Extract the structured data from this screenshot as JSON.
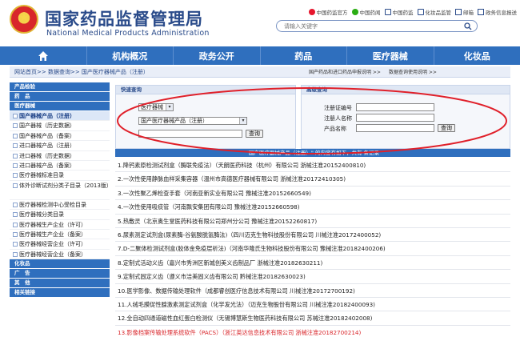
{
  "header": {
    "title": "国家药品监督管理局",
    "subtitle": "National Medical Products Administration",
    "links": [
      {
        "icon": "weibo-icon",
        "label": "中国药监官方"
      },
      {
        "icon": "wechat-icon",
        "label": "中国药闻"
      },
      {
        "icon": "phone-icon",
        "label": "中国药监"
      },
      {
        "icon": "phone-icon",
        "label": "化妆品监管"
      },
      {
        "icon": "mail-icon",
        "label": "邮箱"
      },
      {
        "icon": "mail-icon",
        "label": "政务信息报送"
      }
    ],
    "search_placeholder": "请输入关键字"
  },
  "nav": {
    "home_icon": "home-icon",
    "items": [
      "机构概况",
      "政务公开",
      "药品",
      "医疗器械",
      "化妆品"
    ]
  },
  "breadcrumb": {
    "path": "网站首页>> 数据查询>> 国产医疗器械产品（注册）",
    "links": [
      "国产药品和进口药品申报说明 >>",
      "数据查询使用说明 >>"
    ]
  },
  "sidebar": {
    "cats": [
      "产品检验",
      "药　品",
      "医疗器械",
      "化妆品",
      "广　告",
      "其　他",
      "相关链接"
    ],
    "items": [
      "国产器械产品（注册）",
      "国产器械（历史数据）",
      "国产器械产品（备案）",
      "进口器械产品（注册）",
      "进口器械（历史数据）",
      "进口器械产品（备案）",
      "医疗器械标准目录",
      "体外诊断试剂分类子目录（2013版）",
      "医疗器械检测中心受检目录",
      "医疗器械分类目录",
      "医疗器械生产企业（许可）",
      "医疗器械生产企业（备案）",
      "医疗器械经营企业（许可）",
      "医疗器械经营企业（备案）"
    ]
  },
  "quick": {
    "title": "快速查询",
    "cat_value": "医疗器械",
    "db_value": "国产医疗器械产品（注册）",
    "button": "查询"
  },
  "advanced": {
    "title": "高级查询",
    "fields": [
      "注册证编号",
      "注册人名称",
      "产品名称"
    ],
    "button": "查询"
  },
  "results": {
    "header": "\"国产医疗器械产品（注册）\" 的内容有如下，共有 条记录",
    "rows": [
      "1.降钙素原检测试剂盒（酶联免疫法）（天朗医药科技（杭州）有限公司 浙械注准20152400810)",
      "2.一次性使用静脉血样采集容器（温州市高德医疗器械有限公司 浙械注准20172410305)",
      "3.一次性聚乙烯检查手套（河南亚新实业有限公司 豫械注准20152660549)",
      "4.一次性使用吸痰管（河南飘安集团有限公司 豫械注准20152660598)",
      "5.热敷灵（北京奥生堂医药科技有限公司郑州分公司 豫械注准20152260817)",
      "6.尿素测定试剂盒(尿素酶-谷氨酸脱氢酶法)（四川迈克生物科技股份有限公司 川械注准20172400052)",
      "7.D-二聚体检测试剂盒(胶体金免疫层析法)（河南华隆氏生物科技股份有限公司 豫械注准20182400206)",
      "8.定制式活动义齿（嘉兴市秀洲区新城创美义齿制品厂 浙械注准20182630211)",
      "9.定制式固定义齿（遵义市洁美固义齿有限公司 黔械注准20182630023)",
      "10.医学影像、数据传输处理软件（成都睿创医疗信息技术有限公司 川械注准20172700192)",
      "11.人绒毛膜促性腺激素测定试剂盒（化学发光法）（迈克生物股份有限公司 川械注准20182400093)",
      "12.全自动四通道磁性血红蛋白检测仪（无锡博慧斯生物医药科技有限公司 苏械注准20182402008)",
      "13.影像档案传输处理系统软件（PACS）（浙江英达信息技术有限公司 浙械注准20182700214)"
    ]
  },
  "colors": {
    "brand": "#2a4b8a",
    "nav": "#2f6fbe",
    "highlight": "#d9262b",
    "annotation": "#e0202a"
  }
}
